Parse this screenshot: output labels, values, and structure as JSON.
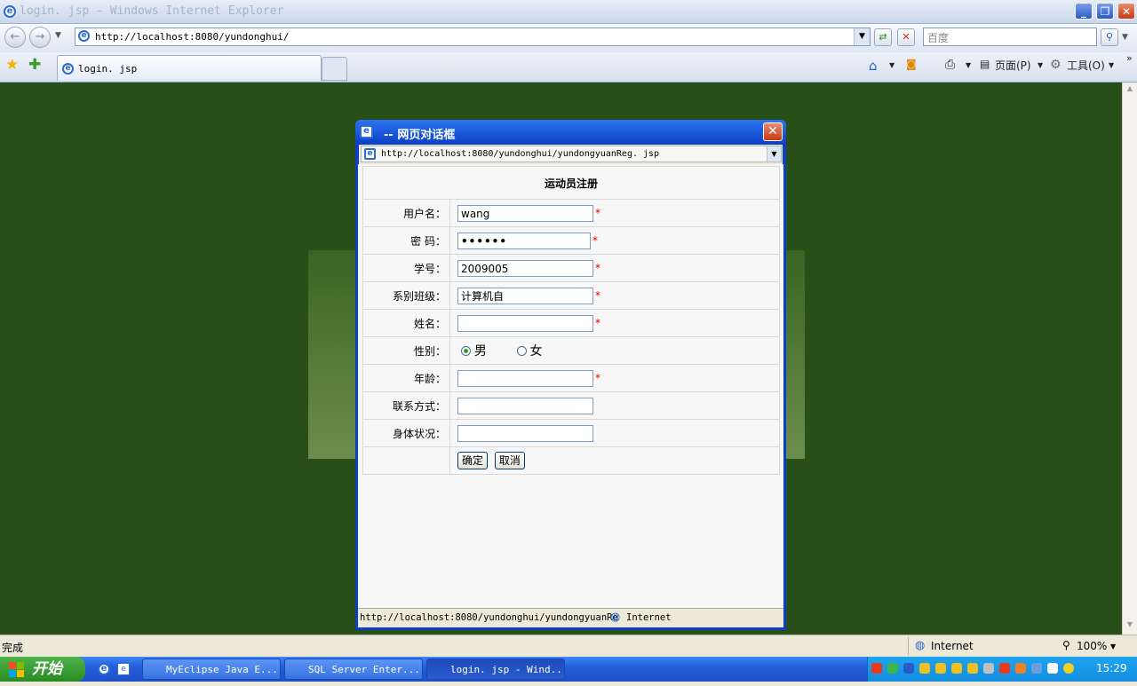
{
  "window": {
    "title": "login. jsp - Windows Internet Explorer"
  },
  "nav": {
    "url": "http://localhost:8080/yundonghui/",
    "search_placeholder": "百度"
  },
  "tabs": [
    {
      "label": "login. jsp"
    }
  ],
  "toolbar": {
    "page_label": "页面(P)",
    "tools_label": "工具(O)"
  },
  "dialog": {
    "title": "-- 网页对话框",
    "url": "http://localhost:8080/yundonghui/yundongyuanReg. jsp",
    "status_url": "http://localhost:8080/yundonghui/yundongyuanRe",
    "status_zone": "Internet",
    "form": {
      "heading": "运动员注册",
      "username_label": "用户名：",
      "username_value": "wang",
      "password_label": "密  码：",
      "password_value": "••••••",
      "student_id_label": "学号：",
      "student_id_value": "2009005",
      "class_label": "系别班级：",
      "class_value": "计算机自",
      "name_label": "姓名：",
      "name_value": "",
      "gender_label": "性别：",
      "gender_male": "男",
      "gender_female": "女",
      "gender_selected": "男",
      "age_label": "年龄：",
      "age_value": "",
      "contact_label": "联系方式：",
      "contact_value": "",
      "health_label": "身体状况：",
      "health_value": "",
      "required_mark": "*",
      "ok_button": "确定",
      "cancel_button": "取消"
    }
  },
  "status": {
    "text": "完成",
    "zone": "Internet",
    "zoom": "100%"
  },
  "taskbar": {
    "start_label": "开始",
    "tasks": [
      {
        "label": "MyEclipse Java E..."
      },
      {
        "label": "SQL Server Enter..."
      },
      {
        "label": "login. jsp - Wind..."
      }
    ],
    "clock": "15:29"
  }
}
